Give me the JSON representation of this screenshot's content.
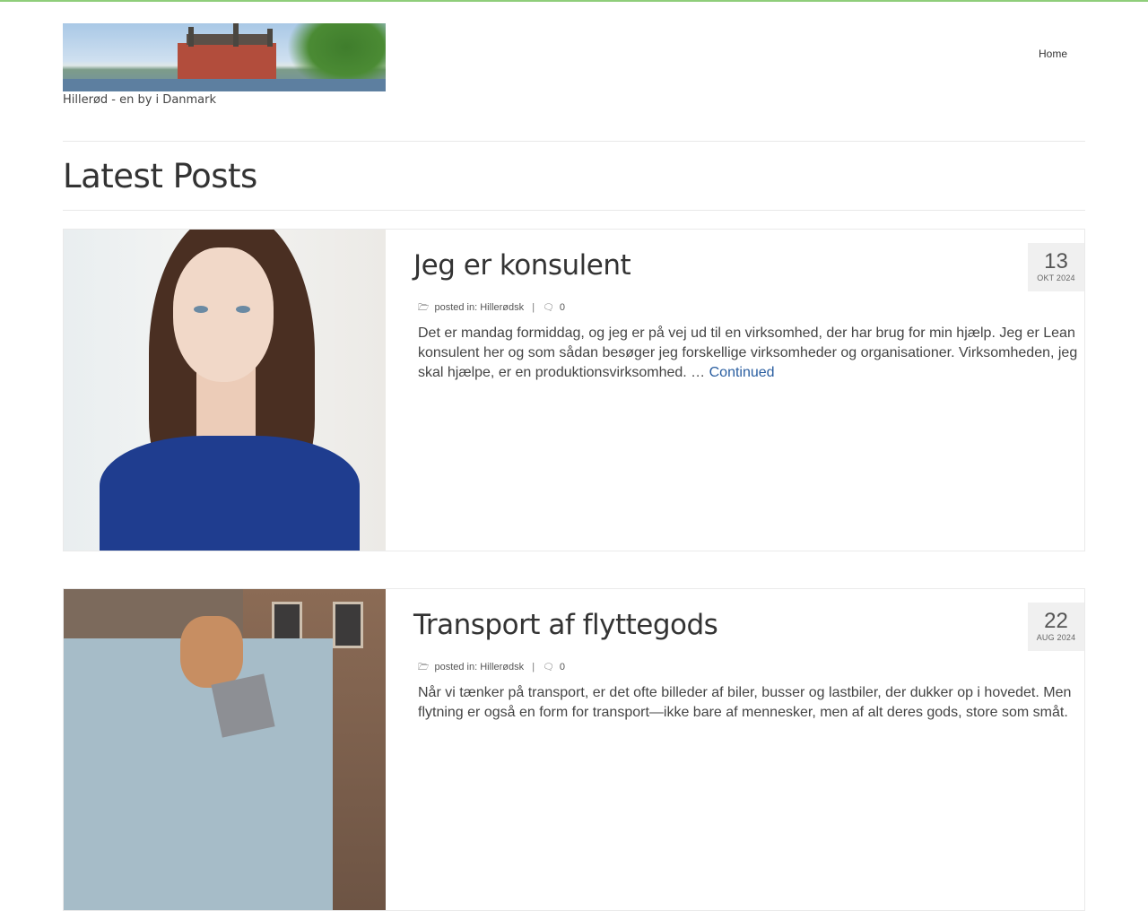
{
  "site": {
    "tagline": "Hillerød - en by i Danmark",
    "logo_alt": "Frederiksborg Slot"
  },
  "nav": {
    "home": "Home"
  },
  "page": {
    "title": "Latest Posts"
  },
  "posts": [
    {
      "title": "Jeg er konsulent",
      "date_day": "13",
      "date_month": "OKT 2024",
      "meta_prefix": "posted in:",
      "category": "Hillerødsk",
      "meta_separator": "|",
      "comments": "0",
      "excerpt": "Det er mandag formiddag, og jeg er på vej ud til en virksomhed, der har brug for min hjælp. Jeg er Lean konsulent her og som sådan besøger jeg forskellige virksomheder og organisationer. Virksomheden, jeg skal hjælpe, er en produktionsvirksomhed. …",
      "continue_label": "Continued",
      "image_subject": "woman-portrait"
    },
    {
      "title": "Transport af flyttegods",
      "date_day": "22",
      "date_month": "AUG 2024",
      "meta_prefix": "posted in:",
      "category": "Hillerødsk",
      "meta_separator": "|",
      "comments": "0",
      "excerpt": "Når vi tænker på transport, er det ofte billeder af biler, busser og lastbiler, der dukker op i hovedet. Men flytning er også en form for transport—ikke bare af mennesker, men af alt deres gods, store som småt.",
      "continue_label": "",
      "image_subject": "moving-truck"
    }
  ],
  "colors": {
    "accent_line": "#8fce7a",
    "link": "#2a5ea0",
    "date_box": "#f0f0f0"
  },
  "icons": {
    "folder": "folder-icon",
    "comment": "comment-icon"
  }
}
